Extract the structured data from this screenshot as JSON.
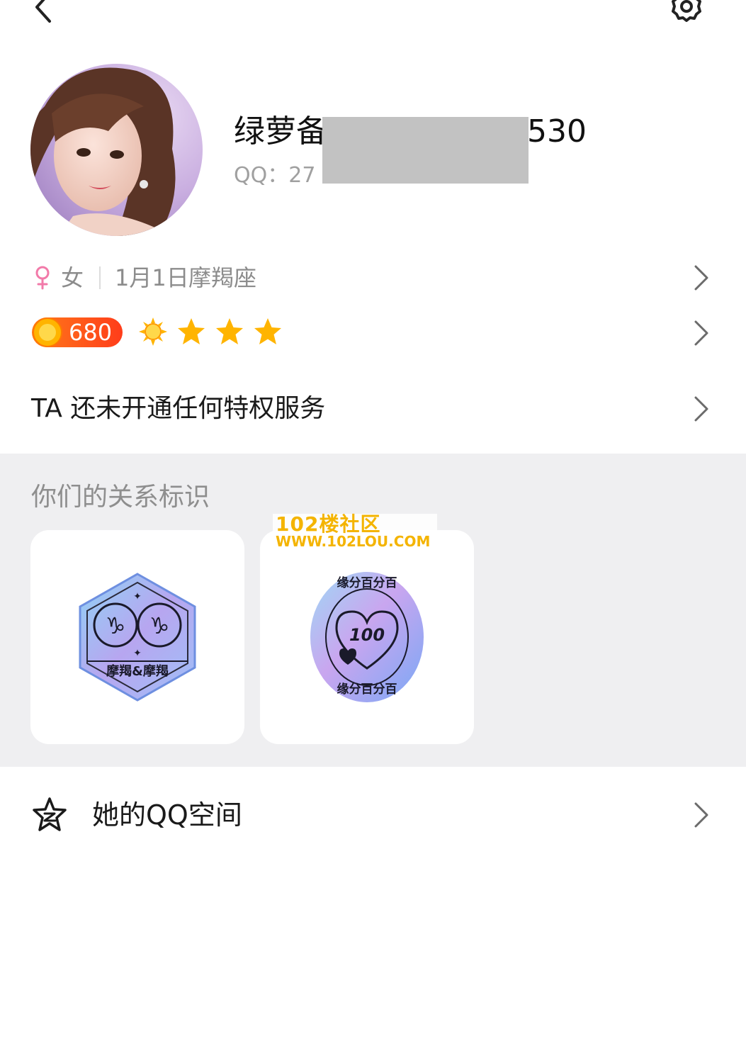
{
  "nav": {
    "back_icon": "chevron-left-icon",
    "settings_icon": "gear-icon"
  },
  "profile": {
    "nickname_visible_start": "绿萝备",
    "nickname_visible_end": "530",
    "qq_label": "QQ：27",
    "redaction_color": "#c2c2c2"
  },
  "info": {
    "gender": "女",
    "gender_icon": "female-icon",
    "birthday": "1月1日",
    "constellation": "摩羯座",
    "level": "680",
    "level_icons": [
      "sun-icon",
      "star-icon",
      "star-icon",
      "star-icon"
    ],
    "privilege_text": "TA 还未开通任何特权服务"
  },
  "relation": {
    "title": "你们的关系标识",
    "badges": [
      {
        "name": "constellation-badge",
        "label": "摩羯&摩羯"
      },
      {
        "name": "fate-badge",
        "label": "缘分百分百",
        "number": "100"
      }
    ]
  },
  "watermark": {
    "line1": "102楼社区",
    "line2": "WWW.102LOU.COM"
  },
  "qzone": {
    "label": "她的QQ空间",
    "icon": "qzone-star-icon"
  },
  "colors": {
    "accent_orange": "#ff5a1a",
    "female_pink": "#f27aa9",
    "star_gold": "#ffb400",
    "section_bg": "#efeff1"
  }
}
